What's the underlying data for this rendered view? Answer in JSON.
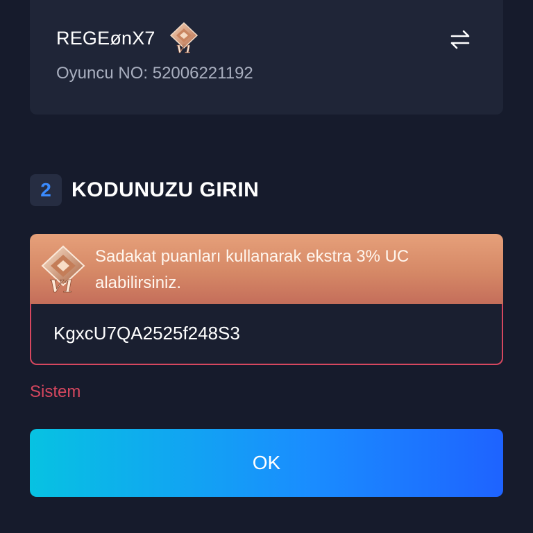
{
  "player": {
    "name": "REGEønX7",
    "id_label": "Oyuncu NO: 52006221192",
    "tier_badge": "V1",
    "badge_icon": "v1-tier-badge-icon",
    "switch_icon": "swap-arrows-icon"
  },
  "step": {
    "number": "2",
    "title": "KODUNUZU GIRIN"
  },
  "loyalty": {
    "badge": "V1",
    "message": "Sadakat puanları kullanarak ekstra 3% UC alabilirsiniz."
  },
  "code_input": {
    "value": "KgxcU7QA2525f248S3"
  },
  "error": {
    "text": "Sistem"
  },
  "ok_button": {
    "label": "OK"
  },
  "colors": {
    "background": "#161b2c",
    "card": "#1f2537",
    "accent_blue": "#3a8bff",
    "error_red": "#d6475f",
    "loyalty_orange": "#e6a07a"
  }
}
